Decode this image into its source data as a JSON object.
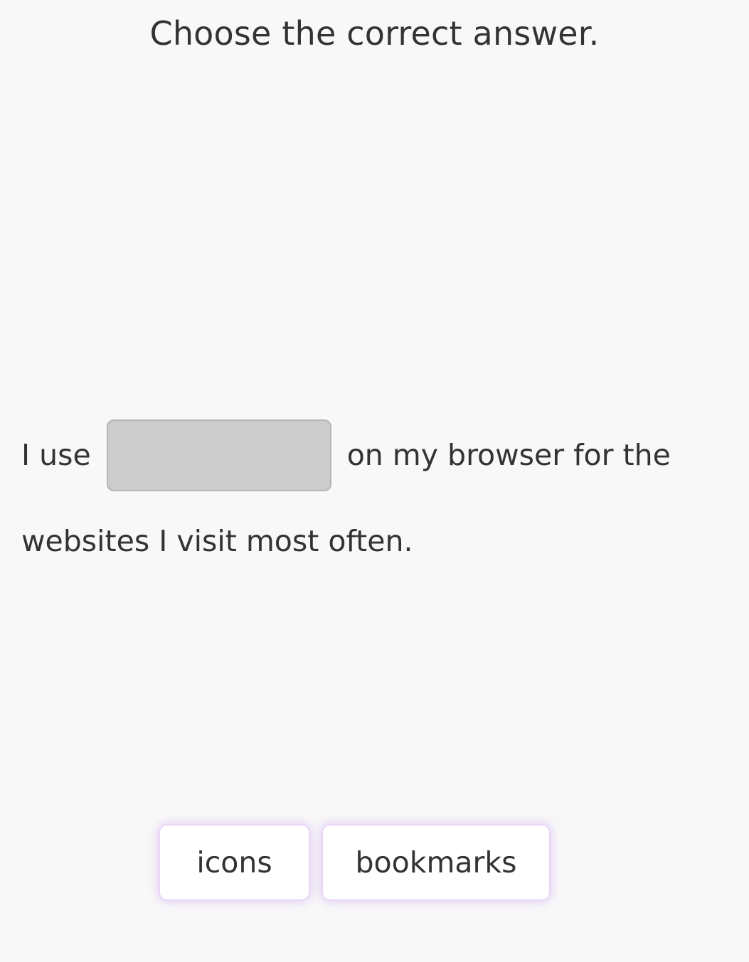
{
  "instruction": "Choose the correct answer.",
  "sentence": {
    "before_blank": "I use",
    "after_blank": "on my browser for the",
    "line2": "websites I visit most often."
  },
  "options": [
    {
      "label": "icons"
    },
    {
      "label": "bookmarks"
    }
  ],
  "colors": {
    "background": "#f8f8f8",
    "blank_fill": "#cccccc",
    "option_glow": "#ead6f7",
    "text": "#333333"
  }
}
